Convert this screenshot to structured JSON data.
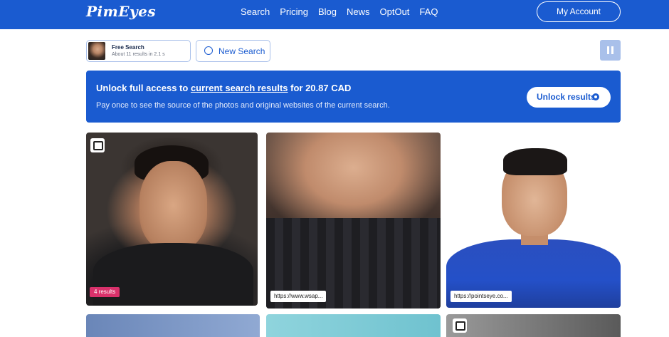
{
  "header": {
    "logo": "PimEyes",
    "nav": [
      "Search",
      "Pricing",
      "Blog",
      "News",
      "OptOut",
      "FAQ"
    ],
    "account_label": "My Account"
  },
  "toolbar": {
    "search_card_title": "Free Search",
    "search_card_subtitle": "About 11 results in 2.1 s",
    "new_search_label": "New Search",
    "pause_icon": "pause-icon"
  },
  "banner": {
    "headline_pre": "Unlock full access to ",
    "headline_link": "current search results",
    "headline_post": " for 20.87 CAD",
    "subtext": "Pay once to see the source of the photos and original websites of the current search.",
    "button_label": "Unlock results"
  },
  "results": [
    {
      "badge": "4 results",
      "url": ""
    },
    {
      "badge": "",
      "url": "https://www.wsap..."
    },
    {
      "badge": "",
      "url": "https://pointseye.co..."
    }
  ],
  "colors": {
    "brand": "#1a5bd0",
    "badge": "#d9316b"
  }
}
